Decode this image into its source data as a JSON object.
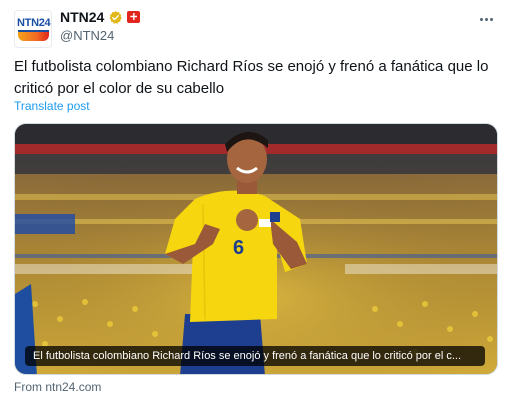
{
  "author": {
    "display_name": "NTN24",
    "handle": "@NTN24",
    "avatar_text": "NTN24",
    "verified_icon": "verified-gold-badge-icon",
    "affiliation_icon": "red-cross-badge-icon"
  },
  "post": {
    "text": "El futbolista colombiano Richard Ríos se enojó y frenó a fanática que lo criticó por el color de su cabello",
    "translate_label": "Translate post"
  },
  "card": {
    "caption": "El futbolista colombiano Richard Ríos se enojó y frenó a fanática que lo criticó por el c...",
    "jersey_number": "6",
    "source": "From ntn24.com"
  },
  "colors": {
    "link": "#1d9bf0",
    "secondary_text": "#536471",
    "verified_gold": "#e2b719",
    "jersey_yellow": "#f5d60f",
    "shorts_blue": "#1e3f8f"
  }
}
